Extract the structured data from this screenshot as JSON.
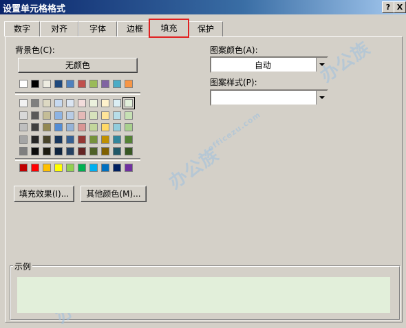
{
  "window": {
    "title": "设置单元格格式",
    "help_button": "?",
    "close_button": "X"
  },
  "tabs": [
    {
      "label": "数字",
      "active": false
    },
    {
      "label": "对齐",
      "active": false
    },
    {
      "label": "字体",
      "active": false
    },
    {
      "label": "边框",
      "active": false
    },
    {
      "label": "填充",
      "active": true
    },
    {
      "label": "保护",
      "active": false
    }
  ],
  "background": {
    "label": "背景色(C):",
    "no_color_button": "无颜色",
    "top_row": [
      "#ffffff",
      "#000000",
      "#eeece1",
      "#1f497d",
      "#4f81bd",
      "#c0504d",
      "#9bbb59",
      "#8064a2",
      "#4bacc6",
      "#f79646"
    ],
    "theme_rows": [
      [
        "#f2f2f2",
        "#7f7f7f",
        "#ddd9c3",
        "#c6d9f0",
        "#dbe5f1",
        "#f2dcdb",
        "#ebf1dd",
        "#fff2cc",
        "#dbeef3",
        "#e2efda"
      ],
      [
        "#d8d8d8",
        "#595959",
        "#c4bd97",
        "#8db3e2",
        "#b8cce4",
        "#e5b9b7",
        "#d7e3bc",
        "#ffe599",
        "#b7dde8",
        "#c6e0b4"
      ],
      [
        "#bfbfbf",
        "#3f3f3f",
        "#938953",
        "#548dd4",
        "#95b3d7",
        "#d99694",
        "#c3d69b",
        "#ffd966",
        "#92cddc",
        "#a9d08e"
      ],
      [
        "#a5a5a5",
        "#262626",
        "#494429",
        "#17365d",
        "#366092",
        "#953734",
        "#76923c",
        "#bf9000",
        "#31859b",
        "#548235"
      ],
      [
        "#7f7f7f",
        "#0c0c0c",
        "#1d1b10",
        "#0f243e",
        "#244061",
        "#632423",
        "#4f6128",
        "#7f6000",
        "#205867",
        "#375623"
      ]
    ],
    "standard_row": [
      "#c00000",
      "#ff0000",
      "#ffc000",
      "#ffff00",
      "#92d050",
      "#00b050",
      "#00b0f0",
      "#0070c0",
      "#002060",
      "#7030a0"
    ],
    "selected_color": "#e2efda",
    "fill_effects_button": "填充效果(I)...",
    "more_colors_button": "其他颜色(M)..."
  },
  "pattern": {
    "color_label": "图案颜色(A):",
    "color_value": "自动",
    "style_label": "图案样式(P):",
    "style_value": ""
  },
  "sample": {
    "label": "示例",
    "color": "#e2efda"
  },
  "watermarks": [
    "办公族",
    "officezu.com"
  ]
}
